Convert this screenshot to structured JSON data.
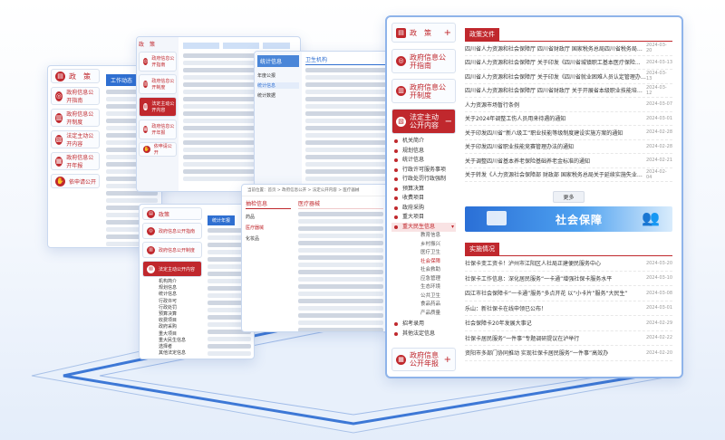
{
  "sidebar": {
    "items": [
      {
        "label": "政　策",
        "icon": "document-icon"
      },
      {
        "label": "政府信息公开指南",
        "icon": "compass-icon"
      },
      {
        "label": "政府信息公开制度",
        "icon": "book-icon"
      },
      {
        "label": "法定主动公开内容",
        "icon": "folder-icon"
      }
    ],
    "subitems": [
      "机关简介",
      "规划信息",
      "统计信息",
      "行政许可服务事项",
      "行政处罚行政强制",
      "预算决算",
      "收费项目",
      "政府采购",
      "重大项目",
      "重大民生信息"
    ],
    "leaves": [
      "教育信息",
      "乡村振兴",
      "医疗卫生",
      "社会保障",
      "社会救助",
      "应急管理",
      "生态环境",
      "公共卫生",
      "食品药品",
      "产品质量"
    ],
    "after": [
      "招考录用",
      "其他法定信息"
    ],
    "bottom": {
      "label": "政府信息公开年报",
      "icon": "report-icon"
    }
  },
  "main": {
    "section1": "政策文件",
    "section1_rows": [
      {
        "title": "四川省人力资源和社会保障厅 四川省财政厅 国家税务总局四川省税务局关于...",
        "date": "2024-03-20"
      },
      {
        "title": "四川省人力资源和社会保障厅 关于印发《四川省城镇职工基本医疗保险...",
        "date": "2024-03-13"
      },
      {
        "title": "四川省人力资源和社会保障厅 关于印发《四川省就业困难人员认定管理办法》...",
        "date": "2024-03-13"
      },
      {
        "title": "四川省人力资源和社会保障厅 四川省财政厅 关于开展省本级职业技能培训...",
        "date": "2024-03-12"
      },
      {
        "title": "人力资源市场暂行条例",
        "date": "2024-03-07"
      },
      {
        "title": "关于2024年调整工伤人员用来待遇的通知",
        "date": "2024-03-01"
      },
      {
        "title": "关于印发四川省“新八级工”职业技能等级制度建设实施方案的通知",
        "date": "2024-02-28"
      },
      {
        "title": "关于印发四川省职业技能竞赛管理办法的通知",
        "date": "2024-02-28"
      },
      {
        "title": "关于调整四川省基本养老保险基础养老金标准的通知",
        "date": "2024-02-21"
      },
      {
        "title": "关于转发《人力资源社会保障部 财政部 国家税务总局关于延续实施失业保险援...",
        "date": "2024-02-04"
      }
    ],
    "more": "更多",
    "banner": "社会保障",
    "section2": "实施情况",
    "section2_rows": [
      {
        "title": "社保卡变工资卡！泸州市江阳区人社局正建便民服务中心",
        "date": "2024-03-20"
      },
      {
        "title": "社保卡工作信息：深化居民服务“一卡通”增强社保卡服务水平",
        "date": "2024-03-10"
      },
      {
        "title": "四江市社会保障卡“一卡通”服务“多点开花 以“小卡片”服务“大民生”",
        "date": "2024-03-08"
      },
      {
        "title": "乐山：新社保卡在线申领已公布！",
        "date": "2024-03-01"
      },
      {
        "title": "社会保障卡20年发展大事记",
        "date": "2024-02-29"
      },
      {
        "title": "社保卡居民服务“一件事”专题调研提议在泸举行",
        "date": "2024-02-22"
      },
      {
        "title": "资阳市多部门协同推动 实现社保卡居民服务“一件事”高效办",
        "date": "2024-02-20"
      }
    ]
  },
  "win_small": {
    "title": "统计信息",
    "tab": "卫生机构",
    "left": [
      "年度公报",
      "统计信息",
      "统计数据"
    ]
  },
  "win_medical": {
    "breadcrumb": "当前位置：首页 > 政府信息公开 > 法定公开内容 > 医疗器械",
    "side": [
      "药品",
      "医疗器械",
      "化妆品"
    ],
    "active": "医疗器械",
    "header": "抽检信息"
  },
  "win_mid": {
    "items": [
      {
        "label": "政策",
        "icon": "document-icon"
      },
      {
        "label": "政府信息公开指南",
        "icon": "compass-icon"
      },
      {
        "label": "政府信息公开制度",
        "icon": "book-icon"
      },
      {
        "label": "法定主动公开内容",
        "icon": "folder-icon"
      }
    ],
    "tab": "统计年报",
    "leaves": [
      "机构简介",
      "规划信息",
      "统计信息",
      "行政许可",
      "行政处罚",
      "预算决算",
      "收费项目",
      "政府采购",
      "重大项目",
      "重大民生信息",
      "选择者",
      "其他法定信息"
    ]
  },
  "win_back": {
    "header": "工作动态",
    "items": [
      {
        "label": "政　策",
        "icon": "document-icon"
      },
      {
        "label": "政府信息公开指南",
        "icon": "compass-icon"
      },
      {
        "label": "政府信息公开制度",
        "icon": "book-icon"
      },
      {
        "label": "法定主动公开内容",
        "icon": "folder-icon"
      },
      {
        "label": "政府信息公开年报",
        "icon": "report-icon"
      },
      {
        "label": "依申请公开",
        "icon": "hand-icon"
      }
    ]
  },
  "win_top": {
    "label": "政　策",
    "items": [
      "政府信息公开指南",
      "政府信息公开制度",
      "法定主动公开内容",
      "政府信息公开年报",
      "依申请公开"
    ]
  }
}
